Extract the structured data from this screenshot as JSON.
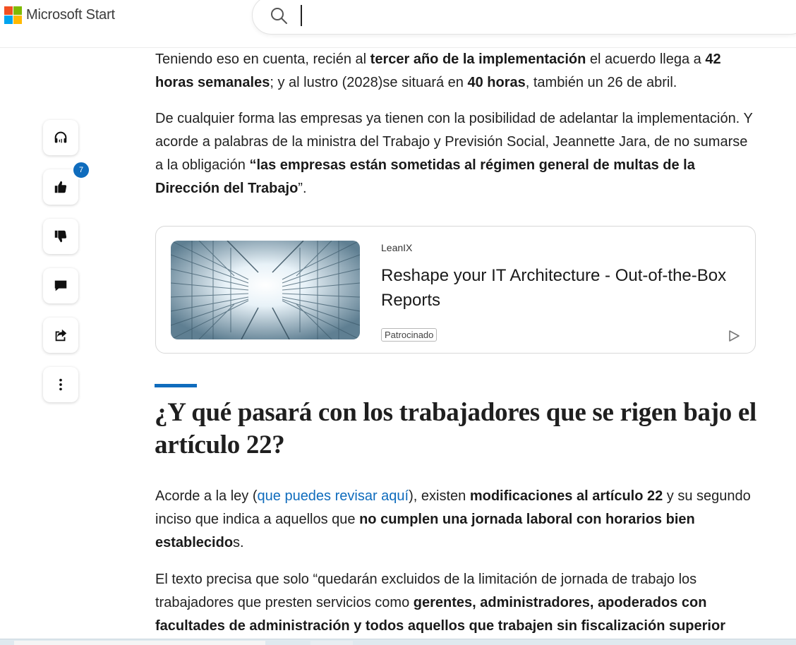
{
  "header": {
    "brand": "Microsoft Start",
    "search_placeholder": ""
  },
  "rail": {
    "like_count": "7"
  },
  "article": {
    "p1": {
      "t1": "Teniendo eso en cuenta, recién al ",
      "b1": "tercer año de la implementación",
      "t2": " el acuerdo llega a ",
      "b2": "42 horas semanales",
      "t3": "; y al lustro (2028)se situará en ",
      "b3": "40 horas",
      "t4": ", también un 26 de abril."
    },
    "p2": {
      "t1": "De cualquier forma las empresas ya tienen con la posibilidad de adelantar la implementación. Y acorde a palabras de la ministra del Trabajo y Previsión Social, Jeannette Jara, de no sumarse a la obligación ",
      "b1": "“las empresas están sometidas al régimen general de multas de la Dirección del Trabajo",
      "t2": "”."
    },
    "section_title": "¿Y qué pasará con los trabajadores que se rigen bajo el artículo 22?",
    "p3": {
      "t1": "Acorde a la ley (",
      "link": "que puedes revisar aquí",
      "t2": "), existen ",
      "b1": "modificaciones al artículo 22",
      "t3": " y su segundo inciso que indica a aquellos que ",
      "b2": "no cumplen una jornada laboral con horarios bien establecido",
      "t4": "s."
    },
    "p4": {
      "t1": "El texto precisa que solo “quedarán excluidos de la limitación de jornada de trabajo los trabajadores que presten servicios como ",
      "b1": "gerentes, administradores, apoderados con facultades de administración y todos aquellos que trabajen sin fiscalización superior"
    }
  },
  "ad": {
    "source": "LeanIX",
    "title": "Reshape your IT Architecture - Out-of-the-Box Reports",
    "badge": "Patrocinado"
  },
  "colors": {
    "accent": "#0f6cbd",
    "logo_red": "#f25022",
    "logo_green": "#7fba00",
    "logo_blue": "#00a4ef",
    "logo_yellow": "#ffb900"
  }
}
